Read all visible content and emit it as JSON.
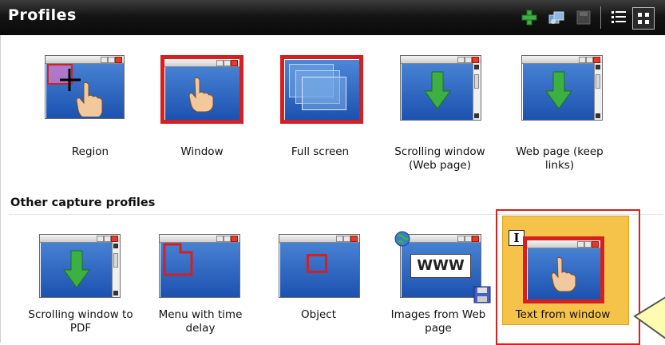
{
  "header": {
    "title": "Profiles",
    "toolbar": [
      "add-icon",
      "manage-icon",
      "save-icon",
      "list-view-icon",
      "thumbnail-view-icon"
    ]
  },
  "profiles": [
    {
      "label": "Region",
      "icon": "region-capture-icon"
    },
    {
      "label": "Window",
      "icon": "window-capture-icon"
    },
    {
      "label": "Full screen",
      "icon": "fullscreen-capture-icon"
    },
    {
      "label": "Scrolling window (Web page)",
      "icon": "scrolling-window-icon"
    },
    {
      "label": "Web page (keep links)",
      "icon": "web-page-keep-links-icon"
    }
  ],
  "other_section": {
    "title": "Other capture profiles",
    "items": [
      {
        "label": "Scrolling window to PDF",
        "icon": "scrolling-pdf-icon"
      },
      {
        "label": "Menu with time delay",
        "icon": "menu-delay-icon"
      },
      {
        "label": "Object",
        "icon": "object-capture-icon"
      },
      {
        "label": "Images from Web page",
        "icon": "web-images-icon",
        "badge": "WWW"
      },
      {
        "label": "Text from window",
        "icon": "text-from-window-icon",
        "selected": true
      }
    ]
  },
  "colors": {
    "accent": "#d42020",
    "selected": "#f6c34a",
    "header": "#1a1a1a"
  }
}
